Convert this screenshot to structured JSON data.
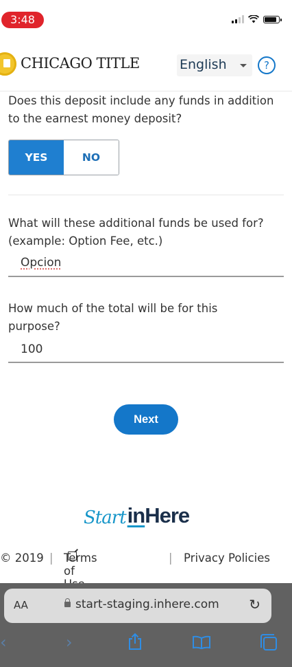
{
  "status_bar": {
    "time": "3:48"
  },
  "header": {
    "logo_text": "CHICAGO TITLE",
    "language": "English",
    "help_icon": "help-circle-icon"
  },
  "form": {
    "q1": "Does this deposit include any funds in addition to the earnest money deposit?",
    "yes_label": "YES",
    "no_label": "NO",
    "selected": "YES",
    "q2": "What will these additional funds be used for? (example: Option Fee, etc.)",
    "q2_value": "Opcion",
    "q3": "How much of the total will be for this purpose?",
    "q3_value": "100",
    "next_label": "Next"
  },
  "brand": {
    "start": "Start",
    "in": "in",
    "here": "Here"
  },
  "footer": {
    "copyright": "© 2019",
    "terms": "Terms of Use",
    "privacy": "Privacy Policies",
    "separator": "|"
  },
  "browser": {
    "aa": "AA",
    "url": "start-staging.inhere.com"
  },
  "colors": {
    "accent": "#1477c9",
    "brand_blue": "#1796c9",
    "status_red": "#e0242b"
  }
}
